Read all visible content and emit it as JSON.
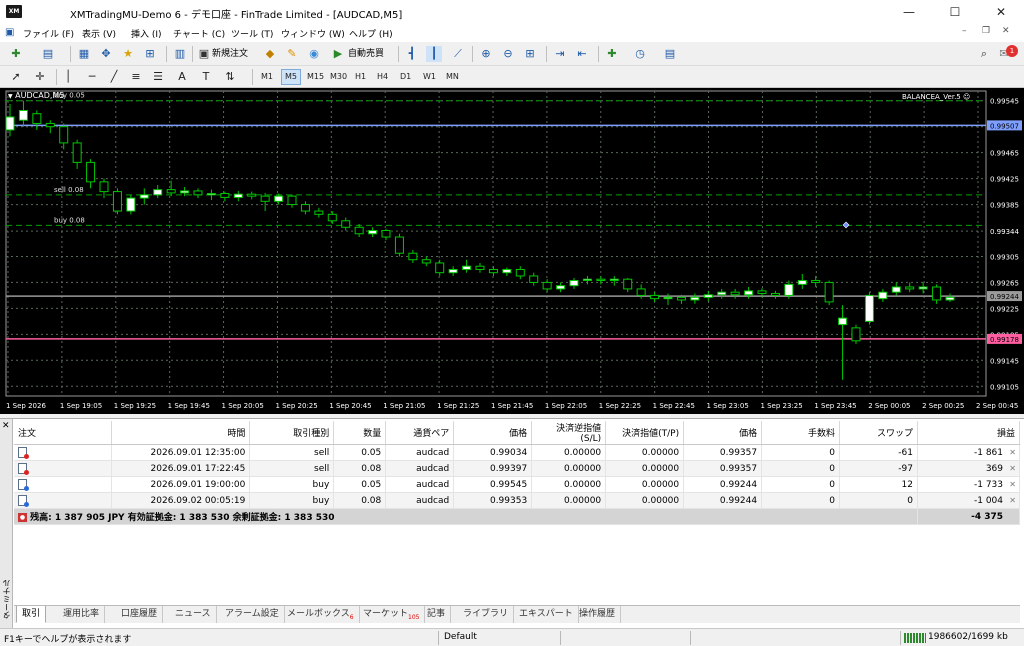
{
  "window": {
    "logo": "XM",
    "title": "XMTradingMU-Demo 6 - デモ口座 - FinTrade Limited - [AUDCAD,M5]",
    "minimize": "—",
    "maximize": "☐",
    "close": "✕"
  },
  "menu": {
    "items": [
      "ファイル (F)",
      "表示 (V)",
      "挿入 (I)",
      "チャート (C)",
      "ツール (T)",
      "ウィンドウ (W)",
      "ヘルプ (H)"
    ],
    "notification_count": "1"
  },
  "toolbar": {
    "new_order": "新規注文",
    "auto_trading": "自動売買",
    "timeframes": [
      "M1",
      "M5",
      "M15",
      "M30",
      "H1",
      "H4",
      "D1",
      "W1",
      "MN"
    ],
    "active_timeframe": "M5"
  },
  "chart": {
    "symbol_label": "AUDCAD,M5",
    "ea_label": "BALANCEA_Ver.5",
    "order_labels": [
      "buy 0.05",
      "sell 0.08",
      "buy 0.08"
    ],
    "price_ticks": [
      "0.99545",
      "0.99507",
      "0.99465",
      "0.99425",
      "0.99385",
      "0.99344",
      "0.99305",
      "0.99265",
      "0.99225",
      "0.99185",
      "0.99145",
      "0.99105"
    ],
    "time_ticks": [
      "1 Sep 2026",
      "1 Sep 19:05",
      "1 Sep 19:25",
      "1 Sep 19:45",
      "1 Sep 20:05",
      "1 Sep 20:25",
      "1 Sep 20:45",
      "1 Sep 21:05",
      "1 Sep 21:25",
      "1 Sep 21:45",
      "1 Sep 22:05",
      "1 Sep 22:25",
      "1 Sep 22:45",
      "1 Sep 23:05",
      "1 Sep 23:25",
      "1 Sep 23:45",
      "2 Sep 00:05",
      "2 Sep 00:25",
      "2 Sep 00:45"
    ],
    "line_labels": {
      "blue": "0.99507",
      "gray": "0.99244",
      "pink": "0.99178"
    },
    "colors": {
      "bg": "#000000",
      "grid": "#5a6a5a",
      "bull": "#ffffff",
      "candle_outline": "#00c800",
      "order_line": "#00a000",
      "blue_line": "#7f9fff",
      "pink_line": "#ff5fa0",
      "gray_line": "#9a9a9a"
    }
  },
  "chart_data": {
    "type": "candlestick",
    "ylim": [
      0.9909,
      0.9956
    ],
    "price_ticks": [
      0.99545,
      0.99505,
      0.99465,
      0.99425,
      0.99385,
      0.99344,
      0.99305,
      0.99265,
      0.99225,
      0.99185,
      0.99145,
      0.99105
    ],
    "candles": [
      {
        "o": 0.995,
        "c": 0.9952,
        "h": 0.9954,
        "l": 0.9949
      },
      {
        "o": 0.99515,
        "c": 0.9953,
        "h": 0.99545,
        "l": 0.99505
      },
      {
        "o": 0.99525,
        "c": 0.9951,
        "h": 0.9953,
        "l": 0.995
      },
      {
        "o": 0.9951,
        "c": 0.99505,
        "h": 0.99515,
        "l": 0.99495
      },
      {
        "o": 0.99505,
        "c": 0.9948,
        "h": 0.9951,
        "l": 0.9947
      },
      {
        "o": 0.9948,
        "c": 0.9945,
        "h": 0.99485,
        "l": 0.9944
      },
      {
        "o": 0.9945,
        "c": 0.9942,
        "h": 0.99455,
        "l": 0.9941
      },
      {
        "o": 0.9942,
        "c": 0.99405,
        "h": 0.99425,
        "l": 0.99395
      },
      {
        "o": 0.99405,
        "c": 0.99375,
        "h": 0.9941,
        "l": 0.9937
      },
      {
        "o": 0.99375,
        "c": 0.99395,
        "h": 0.994,
        "l": 0.9937
      },
      {
        "o": 0.99395,
        "c": 0.994,
        "h": 0.9941,
        "l": 0.99385
      },
      {
        "o": 0.994,
        "c": 0.99408,
        "h": 0.99415,
        "l": 0.99395
      },
      {
        "o": 0.99408,
        "c": 0.99403,
        "h": 0.99422,
        "l": 0.99398
      },
      {
        "o": 0.99403,
        "c": 0.99406,
        "h": 0.99412,
        "l": 0.99398
      },
      {
        "o": 0.99406,
        "c": 0.994,
        "h": 0.9941,
        "l": 0.99395
      },
      {
        "o": 0.994,
        "c": 0.99402,
        "h": 0.99408,
        "l": 0.99392
      },
      {
        "o": 0.99402,
        "c": 0.99396,
        "h": 0.99405,
        "l": 0.9939
      },
      {
        "o": 0.99396,
        "c": 0.99401,
        "h": 0.99406,
        "l": 0.9939
      },
      {
        "o": 0.99401,
        "c": 0.99398,
        "h": 0.99405,
        "l": 0.99393
      },
      {
        "o": 0.99398,
        "c": 0.9939,
        "h": 0.99403,
        "l": 0.99375
      },
      {
        "o": 0.9939,
        "c": 0.99398,
        "h": 0.99402,
        "l": 0.99385
      },
      {
        "o": 0.99398,
        "c": 0.99385,
        "h": 0.994,
        "l": 0.9938
      },
      {
        "o": 0.99385,
        "c": 0.99375,
        "h": 0.9939,
        "l": 0.9937
      },
      {
        "o": 0.99375,
        "c": 0.9937,
        "h": 0.9938,
        "l": 0.99365
      },
      {
        "o": 0.9937,
        "c": 0.9936,
        "h": 0.99375,
        "l": 0.99355
      },
      {
        "o": 0.9936,
        "c": 0.9935,
        "h": 0.99365,
        "l": 0.99345
      },
      {
        "o": 0.9935,
        "c": 0.9934,
        "h": 0.99355,
        "l": 0.99335
      },
      {
        "o": 0.9934,
        "c": 0.99345,
        "h": 0.9935,
        "l": 0.99335
      },
      {
        "o": 0.99345,
        "c": 0.99335,
        "h": 0.99348,
        "l": 0.9933
      },
      {
        "o": 0.99335,
        "c": 0.9931,
        "h": 0.9934,
        "l": 0.99305
      },
      {
        "o": 0.9931,
        "c": 0.993,
        "h": 0.99315,
        "l": 0.99295
      },
      {
        "o": 0.993,
        "c": 0.99295,
        "h": 0.99305,
        "l": 0.9929
      },
      {
        "o": 0.99295,
        "c": 0.9928,
        "h": 0.993,
        "l": 0.99275
      },
      {
        "o": 0.9928,
        "c": 0.99285,
        "h": 0.9929,
        "l": 0.99275
      },
      {
        "o": 0.99285,
        "c": 0.9929,
        "h": 0.993,
        "l": 0.9928
      },
      {
        "o": 0.9929,
        "c": 0.99285,
        "h": 0.99295,
        "l": 0.9928
      },
      {
        "o": 0.99285,
        "c": 0.9928,
        "h": 0.9929,
        "l": 0.99275
      },
      {
        "o": 0.9928,
        "c": 0.99285,
        "h": 0.99288,
        "l": 0.99275
      },
      {
        "o": 0.99285,
        "c": 0.99275,
        "h": 0.9929,
        "l": 0.9927
      },
      {
        "o": 0.99275,
        "c": 0.99265,
        "h": 0.9928,
        "l": 0.9926
      },
      {
        "o": 0.99265,
        "c": 0.99255,
        "h": 0.9927,
        "l": 0.9925
      },
      {
        "o": 0.99255,
        "c": 0.9926,
        "h": 0.99265,
        "l": 0.9925
      },
      {
        "o": 0.9926,
        "c": 0.99268,
        "h": 0.99272,
        "l": 0.99255
      },
      {
        "o": 0.99268,
        "c": 0.9927,
        "h": 0.99275,
        "l": 0.99262
      },
      {
        "o": 0.9927,
        "c": 0.99268,
        "h": 0.99275,
        "l": 0.99262
      },
      {
        "o": 0.99268,
        "c": 0.9927,
        "h": 0.99275,
        "l": 0.9926
      },
      {
        "o": 0.9927,
        "c": 0.99255,
        "h": 0.99272,
        "l": 0.9925
      },
      {
        "o": 0.99255,
        "c": 0.99245,
        "h": 0.99262,
        "l": 0.9924
      },
      {
        "o": 0.99245,
        "c": 0.9924,
        "h": 0.9925,
        "l": 0.99235
      },
      {
        "o": 0.9924,
        "c": 0.99242,
        "h": 0.99248,
        "l": 0.9923
      },
      {
        "o": 0.99242,
        "c": 0.99238,
        "h": 0.99246,
        "l": 0.99232
      },
      {
        "o": 0.99238,
        "c": 0.99242,
        "h": 0.99248,
        "l": 0.99232
      },
      {
        "o": 0.99242,
        "c": 0.99246,
        "h": 0.99252,
        "l": 0.99236
      },
      {
        "o": 0.99246,
        "c": 0.9925,
        "h": 0.99255,
        "l": 0.9924
      },
      {
        "o": 0.9925,
        "c": 0.99246,
        "h": 0.99255,
        "l": 0.9924
      },
      {
        "o": 0.99246,
        "c": 0.99252,
        "h": 0.99258,
        "l": 0.9924
      },
      {
        "o": 0.99252,
        "c": 0.99248,
        "h": 0.99256,
        "l": 0.99242
      },
      {
        "o": 0.99248,
        "c": 0.99245,
        "h": 0.99252,
        "l": 0.9924
      },
      {
        "o": 0.99245,
        "c": 0.99262,
        "h": 0.99268,
        "l": 0.9924
      },
      {
        "o": 0.99262,
        "c": 0.99268,
        "h": 0.99278,
        "l": 0.99255
      },
      {
        "o": 0.99268,
        "c": 0.99265,
        "h": 0.99275,
        "l": 0.99258
      },
      {
        "o": 0.99265,
        "c": 0.99235,
        "h": 0.99268,
        "l": 0.9923
      },
      {
        "o": 0.992,
        "c": 0.9921,
        "h": 0.9923,
        "l": 0.99115
      },
      {
        "o": 0.99195,
        "c": 0.99175,
        "h": 0.992,
        "l": 0.9917
      },
      {
        "o": 0.99205,
        "c": 0.99245,
        "h": 0.9925,
        "l": 0.992
      },
      {
        "o": 0.9924,
        "c": 0.9925,
        "h": 0.99255,
        "l": 0.99235
      },
      {
        "o": 0.9925,
        "c": 0.99258,
        "h": 0.99265,
        "l": 0.99245
      },
      {
        "o": 0.99258,
        "c": 0.99255,
        "h": 0.99265,
        "l": 0.9925
      },
      {
        "o": 0.99255,
        "c": 0.99258,
        "h": 0.99265,
        "l": 0.99248
      },
      {
        "o": 0.99258,
        "c": 0.99238,
        "h": 0.99262,
        "l": 0.99232
      },
      {
        "o": 0.99238,
        "c": 0.99242,
        "h": 0.99248,
        "l": 0.99235
      }
    ],
    "horizontal_lines": [
      {
        "price": 0.99507,
        "color": "#7f9fff"
      },
      {
        "price": 0.994,
        "color": "#00a000",
        "dashed": true,
        "label": "sell 0.08"
      },
      {
        "price": 0.99353,
        "color": "#00a000",
        "dashed": true,
        "label": "buy 0.08"
      },
      {
        "price": 0.99545,
        "color": "#00a000",
        "dashed": true,
        "label": "buy 0.05"
      },
      {
        "price": 0.99244,
        "color": "#9a9a9a"
      },
      {
        "price": 0.99178,
        "color": "#ff5fa0"
      }
    ]
  },
  "terminal": {
    "side_label": "ターミナル",
    "columns": [
      "注文",
      "時間",
      "取引種別",
      "数量",
      "通貨ペア",
      "価格",
      "決済逆指値(S/L)",
      "決済指値(T/P)",
      "価格",
      "手数料",
      "スワップ",
      "損益"
    ],
    "rows": [
      {
        "icon": "sell",
        "ticket": "",
        "time": "2026.09.01 12:35:00",
        "type": "sell",
        "volume": "0.05",
        "symbol": "audcad",
        "price": "0.99034",
        "sl": "0.00000",
        "tp": "0.00000",
        "cur": "0.99357",
        "commission": "0",
        "swap": "-61",
        "profit": "-1 861"
      },
      {
        "icon": "sell",
        "ticket": "",
        "time": "2026.09.01 17:22:45",
        "type": "sell",
        "volume": "0.08",
        "symbol": "audcad",
        "price": "0.99397",
        "sl": "0.00000",
        "tp": "0.00000",
        "cur": "0.99357",
        "commission": "0",
        "swap": "-97",
        "profit": "369"
      },
      {
        "icon": "buy",
        "ticket": "",
        "time": "2026.09.01 19:00:00",
        "type": "buy",
        "volume": "0.05",
        "symbol": "audcad",
        "price": "0.99545",
        "sl": "0.00000",
        "tp": "0.00000",
        "cur": "0.99244",
        "commission": "0",
        "swap": "12",
        "profit": "-1 733"
      },
      {
        "icon": "buy",
        "ticket": "",
        "time": "2026.09.02 00:05:19",
        "type": "buy",
        "volume": "0.08",
        "symbol": "audcad",
        "price": "0.99353",
        "sl": "0.00000",
        "tp": "0.00000",
        "cur": "0.99244",
        "commission": "0",
        "swap": "0",
        "profit": "-1 004"
      }
    ],
    "summary": {
      "text": "残高: 1 387 905 JPY  有効証拠金: 1 383 530  余剰証拠金: 1 383 530",
      "profit": "-4 375"
    },
    "tabs": [
      {
        "label": "取引",
        "badge": ""
      },
      {
        "label": "運用比率",
        "badge": ""
      },
      {
        "label": "口座履歴",
        "badge": ""
      },
      {
        "label": "ニュース",
        "badge": ""
      },
      {
        "label": "アラーム設定",
        "badge": ""
      },
      {
        "label": "メールボックス",
        "badge": "6"
      },
      {
        "label": "マーケット",
        "badge": "105"
      },
      {
        "label": "記事",
        "badge": ""
      },
      {
        "label": "ライブラリ",
        "badge": ""
      },
      {
        "label": "エキスパート",
        "badge": ""
      },
      {
        "label": "操作履歴",
        "badge": ""
      }
    ]
  },
  "status": {
    "help": "F1キーでヘルプが表示されます",
    "profile": "Default",
    "traffic": "1986602/1699 kb"
  }
}
